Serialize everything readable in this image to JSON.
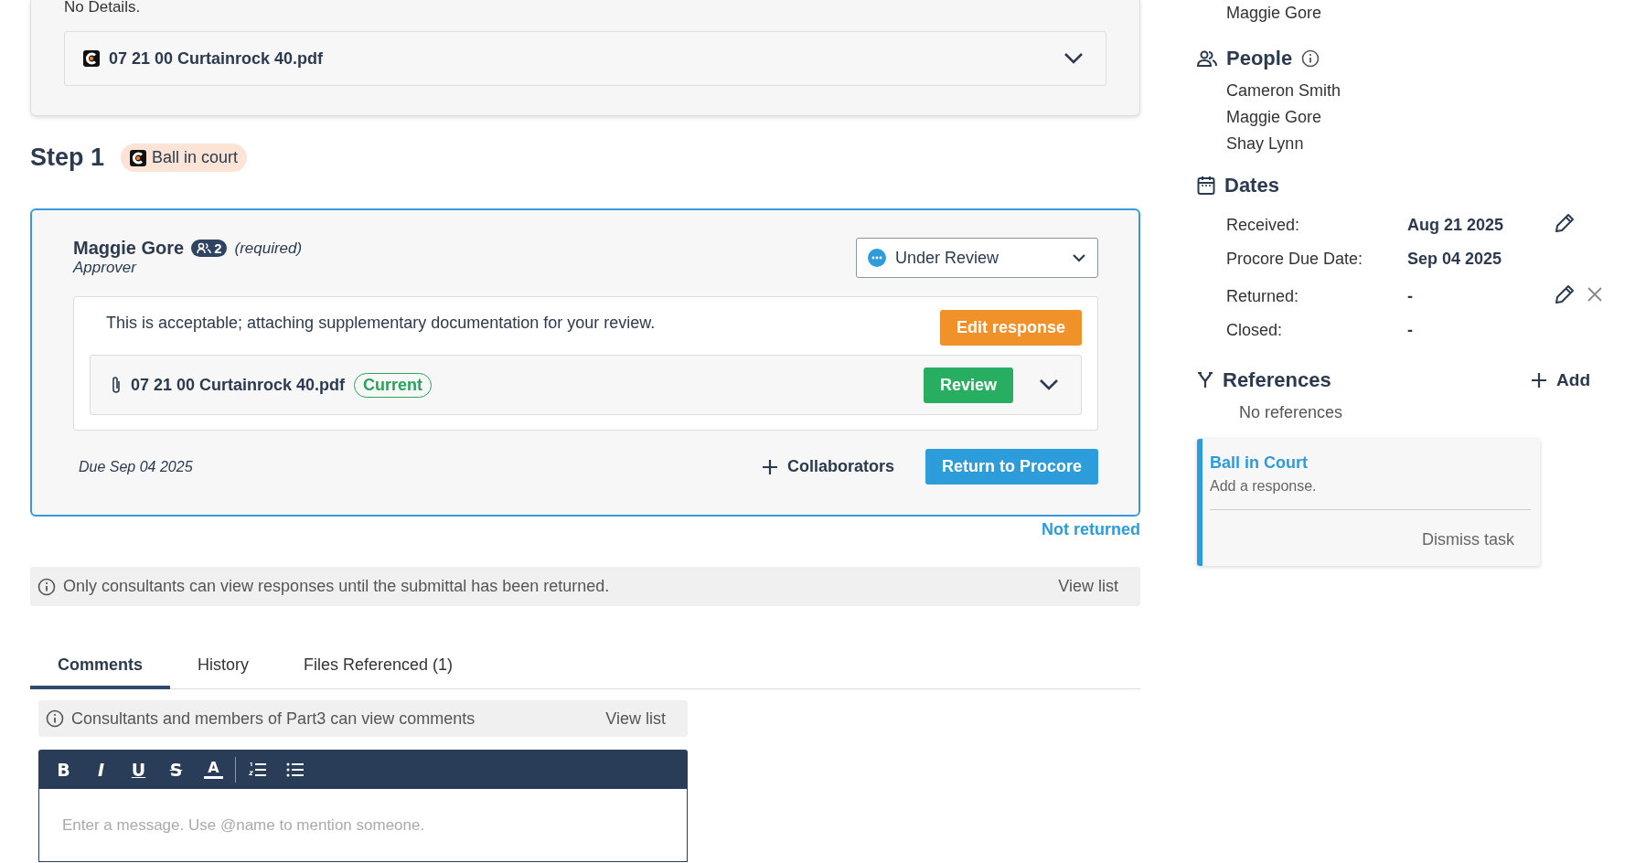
{
  "top_card": {
    "details_text": "No Details.",
    "file": {
      "name": "07 21 00 Curtainrock 40.pdf",
      "expanded": false
    }
  },
  "step": {
    "title": "Step 1",
    "badge": "Ball in court"
  },
  "reviewer": {
    "name": "Maggie Gore",
    "group_count": "2",
    "required": "(required)",
    "role": "Approver",
    "status": "Under Review",
    "response": "This is acceptable; attaching supplementary documentation for your review.",
    "edit_button": "Edit response",
    "attachment": {
      "name": "07 21 00 Curtainrock 40.pdf",
      "tag": "Current",
      "review_button": "Review",
      "expanded": false
    },
    "due": "Due Sep 04 2025",
    "collaborators_button": "Collaborators",
    "return_button": "Return to Procore"
  },
  "return_status": "Not returned",
  "notice": {
    "text": "Only consultants can view responses until the submittal has been returned.",
    "link": "View list"
  },
  "tabs": [
    {
      "label": "Comments",
      "selected": true
    },
    {
      "label": "History",
      "selected": false
    },
    {
      "label": "Files Referenced (1)",
      "selected": false
    }
  ],
  "comments": {
    "notice": {
      "text": "Consultants and members of Part3 can view comments",
      "link": "View list"
    },
    "toolbar": [
      {
        "kind": "bold",
        "label": "B"
      },
      {
        "kind": "italic",
        "label": "I"
      },
      {
        "kind": "underline",
        "label": "U"
      },
      {
        "kind": "strike",
        "label": "S"
      },
      {
        "kind": "color",
        "label": "A"
      },
      {
        "kind": "ordered"
      },
      {
        "kind": "bullet"
      }
    ],
    "placeholder": "Enter a message. Use @name to mention someone."
  },
  "sidebar": {
    "top_names": [
      "Maggie Gore"
    ],
    "people": {
      "title": "People",
      "names": [
        "Cameron Smith",
        "Maggie Gore",
        "Shay Lynn"
      ]
    },
    "dates": {
      "title": "Dates",
      "rows": [
        {
          "label": "Received:",
          "value": "Aug 21 2025",
          "editable": true,
          "clearable": false
        },
        {
          "label": "Procore Due Date:",
          "value": "Sep 04 2025",
          "editable": false,
          "clearable": false
        },
        {
          "label": "Returned:",
          "value": "-",
          "editable": true,
          "clearable": true
        },
        {
          "label": "Closed:",
          "value": "-",
          "editable": false,
          "clearable": false
        }
      ]
    },
    "references": {
      "title": "References",
      "add": "Add",
      "empty": "No references"
    },
    "task": {
      "title": "Ball in Court",
      "text": "Add a response.",
      "dismiss": "Dismiss task"
    }
  }
}
